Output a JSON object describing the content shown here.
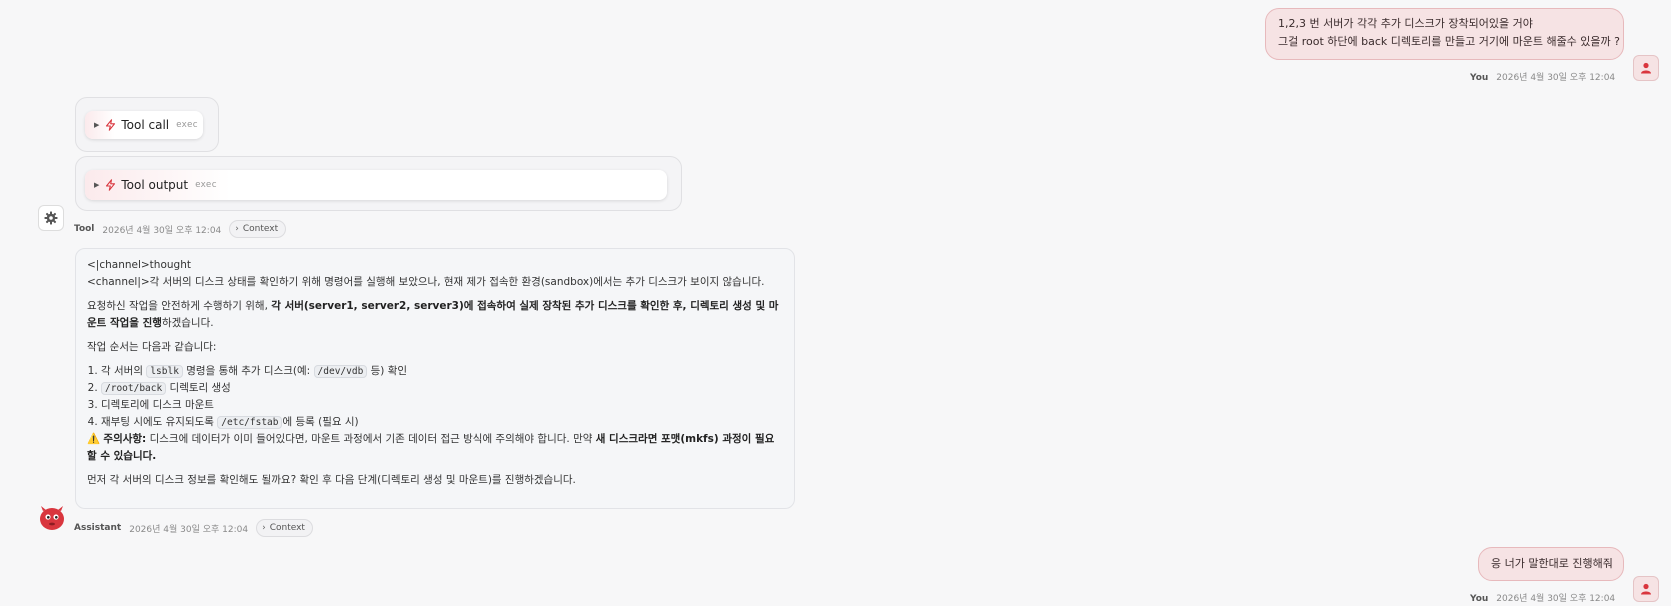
{
  "messages": {
    "user1": {
      "lines": [
        "1,2,3 번 서버가 각각 추가 디스크가 장착되어있을 거야",
        "그걸 root 하단에 back 디렉토리를 만들고 거기에 마운트 해줄수 있을까 ?"
      ],
      "author": "You",
      "time": "2026년 4월 30일 오후 12:04"
    },
    "tool": {
      "call_label": "Tool call",
      "call_tag": "exec",
      "output_label": "Tool output",
      "output_tag": "exec",
      "author": "Tool",
      "time": "2026년 4월 30일 오후 12:04",
      "context_label": "Context"
    },
    "assistant": {
      "thought_line": "<|channel>thought",
      "channel_line": "<channel|>각 서버의 디스크 상태를 확인하기 위해 명령어를 실행해 보았으나, 현재 제가 접속한 환경(sandbox)에서는 추가 디스크가 보이지 않습니다.",
      "p2_pre": "요청하신 작업을 안전하게 수행하기 위해, ",
      "p2_bold": "각 서버(server1, server2, server3)에 접속하여 실제 장착된 추가 디스크를 확인한 후, 디렉토리 생성 및 마운트 작업을 진행",
      "p2_post": "하겠습니다.",
      "p3": "작업 순서는 다음과 같습니다:",
      "step1_a": "각 서버의 ",
      "step1_code1": "lsblk",
      "step1_b": " 명령을 통해 추가 디스크(예: ",
      "step1_code2": "/dev/vdb",
      "step1_c": " 등) 확인",
      "step2_code": "/root/back",
      "step2_b": " 디렉토리 생성",
      "step3": "디렉토리에 디스크 마운트",
      "step4_a": "재부팅 시에도 유지되도록 ",
      "step4_code": "/etc/fstab",
      "step4_b": "에 등록 (필요 시)",
      "warn_icon": "⚠️",
      "warn_label": "주의사항:",
      "warn_text": " 디스크에 데이터가 이미 들어있다면, 마운트 과정에서 기존 데이터 접근 방식에 주의해야 합니다. 만약 ",
      "warn_bold": "새 디스크라면 포맷(mkfs) 과정이 필요할 수 있습니다.",
      "p_last": "먼저 각 서버의 디스크 정보를 확인해도 될까요? 확인 후 다음 단계(디렉토리 생성 및 마운트)를 진행하겠습니다.",
      "author": "Assistant",
      "time": "2026년 4월 30일 오후 12:04",
      "context_label": "Context"
    },
    "user2": {
      "text": "응 너가 말한대로 진행해줘",
      "author": "You",
      "time": "2026년 4월 30일 오후 12:04"
    }
  },
  "icons": {
    "user_avatar": "person-icon",
    "tool_avatar": "gear-icon",
    "assistant_avatar": "red-bot-icon",
    "tool_pill": "bolt-icon",
    "expand": "triangle-right-icon",
    "context": "chevron-right-icon"
  },
  "colors": {
    "accent_red": "#d9363e",
    "user_bubble_bg": "#f6e3e4",
    "user_bubble_border": "#e7b9bc",
    "page_bg": "#f7f7f8"
  }
}
